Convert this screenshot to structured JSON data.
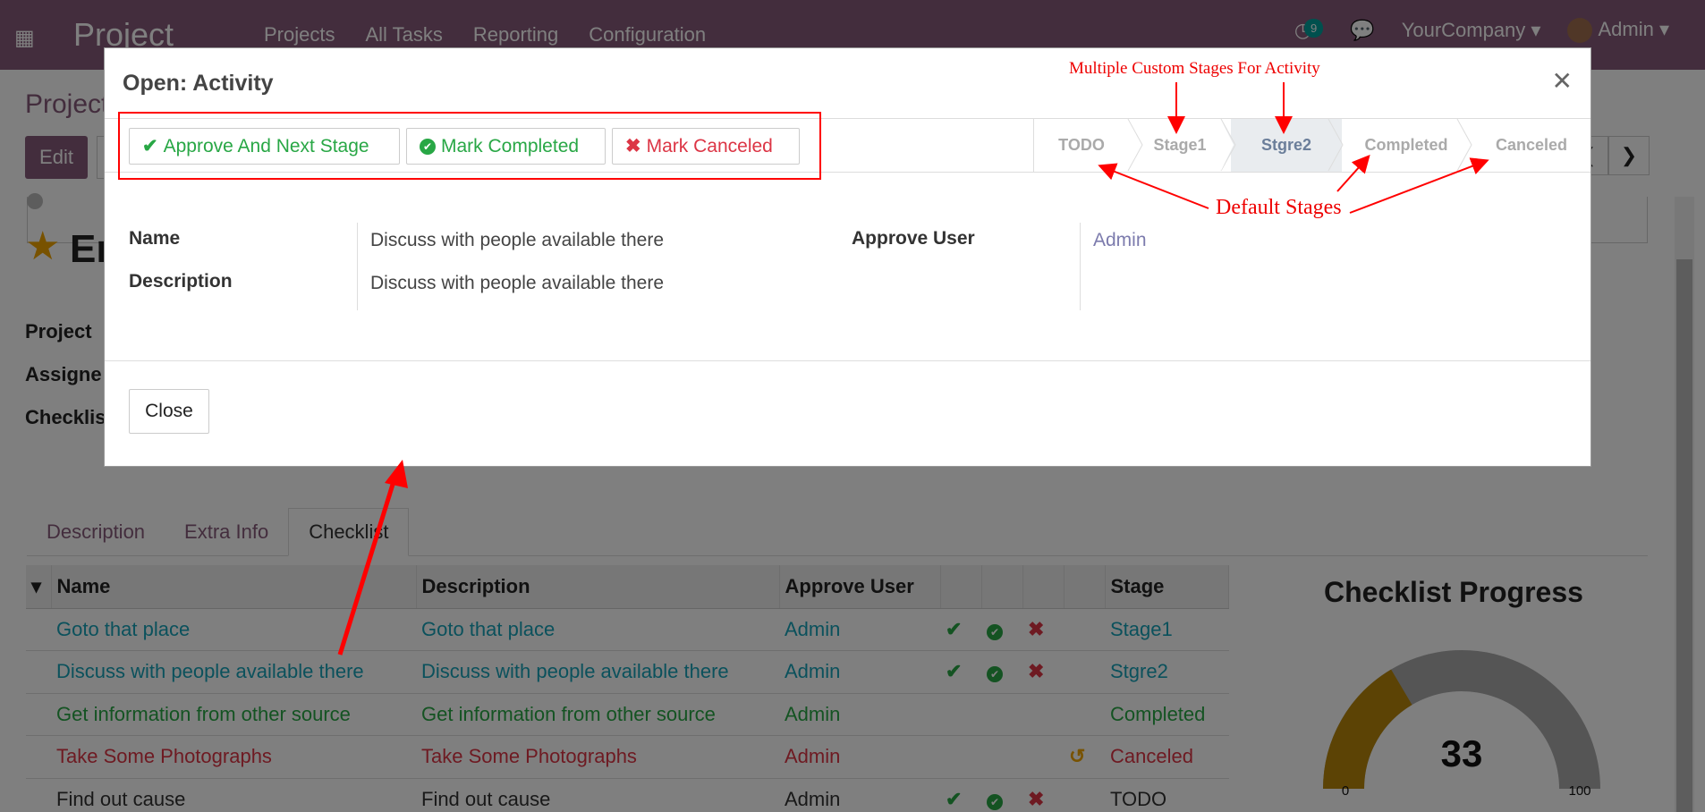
{
  "navbar": {
    "brand": "Project",
    "menu": [
      "Projects",
      "All Tasks",
      "Reporting",
      "Configuration"
    ],
    "activity_count": "9",
    "company": "YourCompany",
    "user": "Admin"
  },
  "control_panel": {
    "title": "Project",
    "edit_label": "Edit"
  },
  "record": {
    "title_partial": "En",
    "labels": [
      "Project",
      "Assigne",
      "Checklis"
    ]
  },
  "tabs": [
    "Description",
    "Extra Info",
    "Checklist"
  ],
  "checklist": {
    "headers": [
      "Name",
      "Description",
      "Approve User",
      "",
      "",
      "",
      "",
      "Stage"
    ],
    "rows": [
      {
        "name": "Goto that place",
        "description": "Goto that place",
        "user": "Admin",
        "stage": "Stage1",
        "style": "info",
        "icons": "approve"
      },
      {
        "name": "Discuss with people available there",
        "description": "Discuss with people available there",
        "user": "Admin",
        "stage": "Stgre2",
        "style": "info",
        "icons": "approve"
      },
      {
        "name": "Get information from other source",
        "description": "Get information from other source",
        "user": "Admin",
        "stage": "Completed",
        "style": "success",
        "icons": "none"
      },
      {
        "name": "Take Some Photographs",
        "description": "Take Some Photographs",
        "user": "Admin",
        "stage": "Canceled",
        "style": "danger",
        "icons": "undo"
      },
      {
        "name": "Find out cause",
        "description": "Find out cause",
        "user": "Admin",
        "stage": "TODO",
        "style": "muted",
        "icons": "approve"
      }
    ]
  },
  "gauge": {
    "title": "Checklist Progress",
    "value": 33,
    "min": "0",
    "max": "100",
    "color_fill": "#b8860b",
    "color_track": "#aaaaaa"
  },
  "modal": {
    "title": "Open: Activity",
    "buttons": {
      "approve": "Approve And Next Stage",
      "complete": "Mark Completed",
      "cancel": "Mark Canceled"
    },
    "stages": [
      "TODO",
      "Stage1",
      "Stgre2",
      "Completed",
      "Canceled"
    ],
    "active_stage": "Stgre2",
    "fields": {
      "name_label": "Name",
      "name_value": "Discuss with people available there",
      "description_label": "Description",
      "description_value": "Discuss with people available there",
      "approve_user_label": "Approve User",
      "approve_user_value": "Admin"
    },
    "close_label": "Close"
  },
  "annotations": {
    "custom_stages": "Multiple Custom Stages For Activity",
    "default_stages": "Default Stages"
  },
  "colors": {
    "brand": "#875a7b",
    "success": "#28a745",
    "danger": "#dc3545",
    "info": "#17a2b8",
    "annotation": "#ff0000"
  }
}
